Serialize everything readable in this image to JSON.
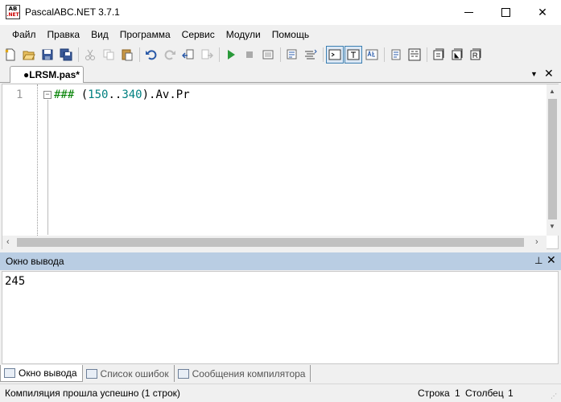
{
  "window": {
    "title": "PascalABC.NET 3.7.1",
    "icon_text_top": "AB",
    "icon_text_bottom": ".NET",
    "minimize_icon": "minimize-icon",
    "maximize_icon": "maximize-icon",
    "close_glyph": "✕"
  },
  "menu": {
    "items": [
      "Файл",
      "Правка",
      "Вид",
      "Программа",
      "Сервис",
      "Модули",
      "Помощь"
    ]
  },
  "toolbar": {
    "buttons": [
      "new-file-icon",
      "open-folder-icon",
      "save-icon",
      "save-all-icon",
      "cut-icon",
      "copy-icon",
      "paste-icon",
      "undo-icon",
      "redo-icon",
      "nav-back-icon",
      "nav-forward-icon",
      "run-icon",
      "stop-icon",
      "debug-icon",
      "indent-icon",
      "format-icon",
      "console-icon",
      "text-icon",
      "spell-icon",
      "class-icon",
      "code-icon",
      "book1-icon",
      "book2-icon",
      "book3-icon"
    ]
  },
  "tabs": {
    "document": "●LRSM.pas*",
    "dropdown_glyph": "▼",
    "close_glyph": "✕"
  },
  "editor": {
    "line_number": "1",
    "fold_glyph": "−",
    "code_kw": "###",
    "code_sp": " ",
    "code_open": "(",
    "code_num1": "150",
    "code_range": "..",
    "code_num2": "340",
    "code_close": ").",
    "code_rest": "Av.Pr"
  },
  "output": {
    "title": "Окно вывода",
    "pin_glyph": "⊥",
    "close_glyph": "✕",
    "text": "245"
  },
  "bottom_tabs": {
    "output": "Окно вывода",
    "errors": "Список ошибок",
    "compiler": "Сообщения компилятора"
  },
  "status": {
    "message": "Компиляция прошла успешно (1 строк)",
    "row_label": "Строка",
    "row_value": "1",
    "col_label": "Столбец",
    "col_value": "1"
  },
  "colors": {
    "output_header": "#b9cde3",
    "keyword": "#008000",
    "number": "#008080"
  }
}
